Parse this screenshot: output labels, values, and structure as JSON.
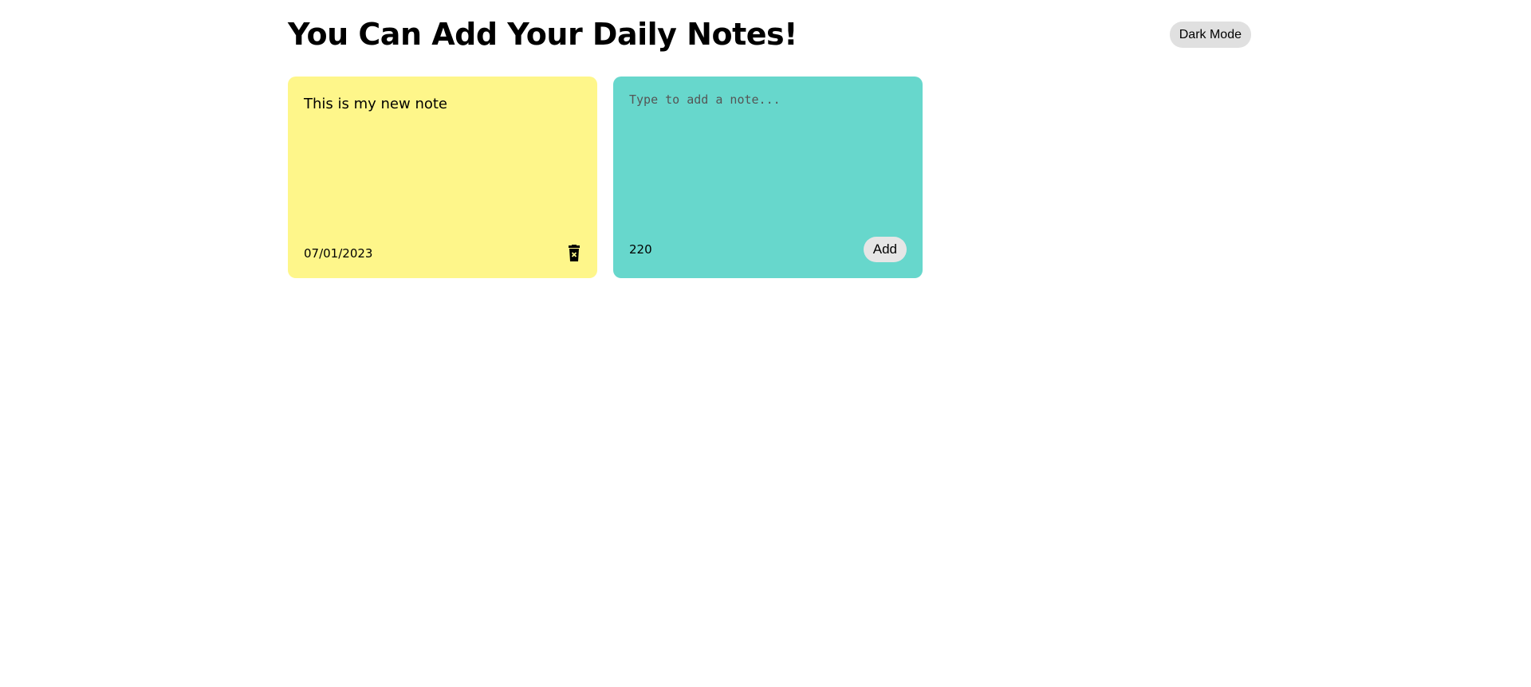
{
  "header": {
    "title": "You Can Add Your Daily Notes!",
    "dark_mode_label": "Dark Mode"
  },
  "notes": [
    {
      "text": "This is my new note",
      "date": "07/01/2023",
      "icon": "trash-icon",
      "color": "#fef68a"
    }
  ],
  "new_note": {
    "placeholder": "Type to add a note...",
    "value": "",
    "remaining": "220",
    "add_label": "Add",
    "color": "#67d7cc"
  }
}
